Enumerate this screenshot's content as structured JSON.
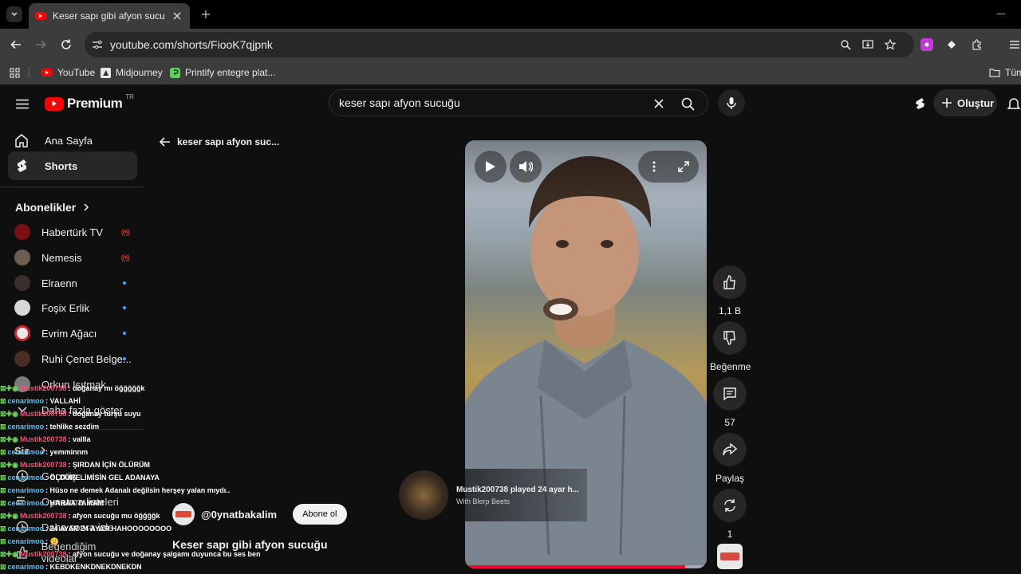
{
  "browser": {
    "tab_title": "Keser sapı gibi afyon sucuğu - Y",
    "url": "youtube.com/shorts/FiooK7qjpnk",
    "bookmarks": [
      {
        "label": "YouTube"
      },
      {
        "label": "Midjourney"
      },
      {
        "label": "Printify entegre plat..."
      },
      {
        "label": "Tüm"
      }
    ]
  },
  "header": {
    "logo_text": "Premium",
    "logo_country": "TR",
    "search_value": "keser sapı afyon sucuğu",
    "create_label": "Oluştur"
  },
  "sidebar": {
    "home_label": "Ana Sayfa",
    "shorts_label": "Shorts",
    "subscriptions_label": "Abonelikler",
    "subscriptions": [
      {
        "name": "Habertürk TV",
        "status": "live"
      },
      {
        "name": "Nemesis",
        "status": "live"
      },
      {
        "name": "Elraenn",
        "status": "new"
      },
      {
        "name": "Foşix Erlik",
        "status": "new"
      },
      {
        "name": "Evrim Ağacı",
        "status": "new"
      },
      {
        "name": "Ruhi Çenet Belge...",
        "status": "new"
      },
      {
        "name": "Orkun Işıtmak",
        "status": ""
      }
    ],
    "show_more_label": "Daha fazla göster",
    "you_label": "Siz",
    "history_label": "Geçmiş",
    "playlists_label": "Oynatma listeleri",
    "watch_later_label": "Daha sonra izle",
    "liked_label": "Beğendiğim videolar"
  },
  "search_back": {
    "label": "keser sapı afyon suc..."
  },
  "chat": [
    {
      "user": "Mustik200738",
      "type": "u1",
      "text": ": doğanay mı öğğğğğk"
    },
    {
      "user": "cenarimoo",
      "type": "u2",
      "text": ": VALLAHİ"
    },
    {
      "user": "Mustik200738",
      "type": "u1",
      "text": ": doğanay turşu suyu"
    },
    {
      "user": "cenarimoo",
      "type": "u2",
      "text": ": tehlike sezdim"
    },
    {
      "user": "Mustik200738",
      "type": "u1",
      "text": ": vallla"
    },
    {
      "user": "cenarimoo",
      "type": "u2",
      "text": ": yemminnm"
    },
    {
      "user": "Mustik200738",
      "type": "u1",
      "text": ": ŞIRDAN İÇİN ÖLÜRÜM"
    },
    {
      "user": "cenarimoo",
      "type": "u2",
      "text": ": ÖLDÜRELİMİSİN GEL ADANAYA"
    },
    {
      "user": "cenarimoo",
      "type": "u2",
      "text": ": Hüso ne demek Adanalı değilsin herşey yalan mıydı.."
    },
    {
      "user": "cenarimoo",
      "type": "u2",
      "text": ": HARAA TAMAM"
    },
    {
      "user": "Mustik200738",
      "type": "u1",
      "text": ": afyon sucuğu mu öğğğğk"
    },
    {
      "user": "cenarimoo",
      "type": "u2",
      "text": ": 24 AYAR 24 AYAR HAHOOOOOOOO"
    },
    {
      "user": "cenarimoo",
      "type": "u2",
      "text": ": 🙂"
    },
    {
      "user": "Mustik200738",
      "type": "u1",
      "text": ": afyon sucuğu ve doğanay şalgamı duyunca bu ses ben"
    },
    {
      "user": "cenarimoo",
      "type": "u2",
      "text": ": KEBDKENKDNEKDNEKDN"
    }
  ],
  "short": {
    "channel": "@0ynatbakalim",
    "subscribe_label": "Abone ol",
    "title": "Keser sapı gibi afyon sucuğu",
    "music_title": "Mustik200738 played 24 ayar h...",
    "music_subtitle": "With Blerp Beets",
    "progress_fraction": 0.91
  },
  "actions": {
    "like_count": "1,1 B",
    "dislike_label": "Beğenme",
    "comments_count": "57",
    "share_label": "Paylaş",
    "remix_count": "1"
  },
  "colors": {
    "yt_red": "#ff0000",
    "chat_user_red": "#ff4a77",
    "chat_user_blue": "#4fc3ff",
    "progress": "#ff0033"
  }
}
